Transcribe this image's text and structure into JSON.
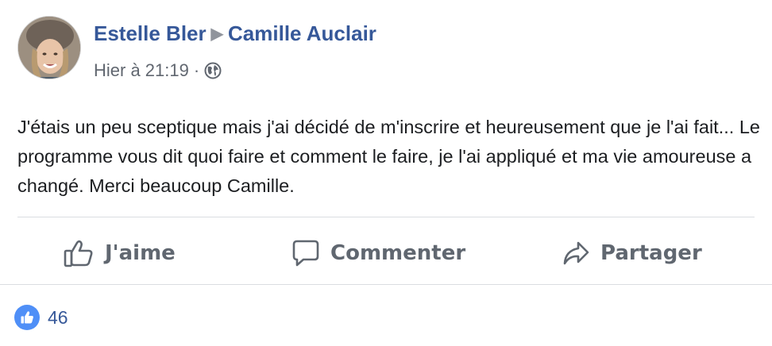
{
  "post": {
    "author": "Estelle Bler",
    "recipient": "Camille Auclair",
    "timestamp": "Hier à 21:19",
    "separator": "·",
    "privacy_icon": "globe-icon",
    "text": "J'étais un peu sceptique mais j'ai décidé de m'inscrire et heureusement que je l'ai fait... Le programme vous dit quoi faire et comment le faire, je l'ai appliqué et ma vie amoureuse a changé. Merci beaucoup Camille."
  },
  "actions": {
    "like_label": "J'aime",
    "comment_label": "Commenter",
    "share_label": "Partager"
  },
  "reactions": {
    "icon": "thumbs-up-icon",
    "count": "46"
  },
  "colors": {
    "link": "#365899",
    "action_text": "#606770",
    "like_badge": "#4f8ff7"
  }
}
